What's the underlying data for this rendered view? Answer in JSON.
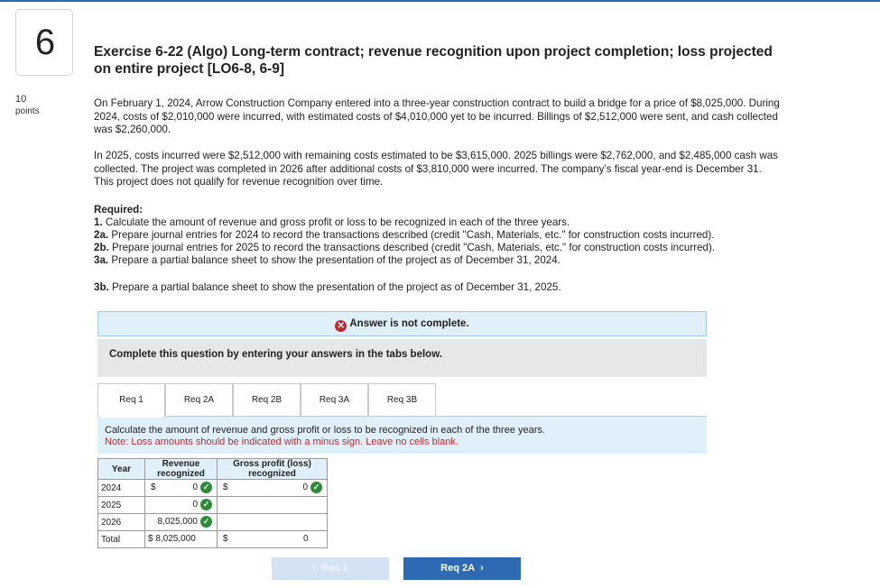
{
  "question": {
    "number": "6",
    "points_value": "10",
    "points_label": "points"
  },
  "title": "Exercise 6-22 (Algo) Long-term contract; revenue recognition upon project completion; loss projected on entire project [LO6-8, 6-9]",
  "paragraphs": [
    "On February 1, 2024, Arrow Construction Company entered into a three-year construction contract to build a bridge for a price of $8,025,000. During 2024, costs of $2,010,000 were incurred, with estimated costs of $4,010,000 yet to be incurred. Billings of $2,512,000 were sent, and cash collected was $2,260,000.",
    "In 2025, costs incurred were $2,512,000 with remaining costs estimated to be $3,615,000. 2025 billings were $2,762,000, and $2,485,000 cash was collected. The project was completed in 2026 after additional costs of $3,810,000 were incurred. The company’s fiscal year-end is December 31. This project does not qualify for revenue recognition over time."
  ],
  "required": {
    "heading": "Required:",
    "items": [
      {
        "num": "1.",
        "text": " Calculate the amount of revenue and gross profit or loss to be recognized in each of the three years."
      },
      {
        "num": "2a.",
        "text": " Prepare journal entries for 2024 to record the transactions described (credit \"Cash, Materials, etc.\" for construction costs incurred)."
      },
      {
        "num": "2b.",
        "text": " Prepare journal entries for 2025 to record the transactions described (credit \"Cash, Materials, etc.\" for construction costs incurred)."
      },
      {
        "num": "3a.",
        "text": " Prepare a partial balance sheet to show the presentation of the project as of December 31, 2024."
      },
      {
        "num": "3b.",
        "text": " Prepare a partial balance sheet to show the presentation of the project as of December 31, 2025."
      }
    ]
  },
  "status": {
    "text": "Answer is not complete.",
    "icon": "x-circle-icon",
    "color": "#c0282d"
  },
  "instruction": "Complete this question by entering your answers in the tabs below.",
  "tabs": [
    {
      "label": "Req 1"
    },
    {
      "label": "Req 2A"
    },
    {
      "label": "Req 2B"
    },
    {
      "label": "Req 3A"
    },
    {
      "label": "Req 3B"
    }
  ],
  "active_tab": "Req 1",
  "panel": {
    "text": "Calculate the amount of revenue and gross profit or loss to be recognized in each of the three years.",
    "note": "Note: Loss amounts should be indicated with a minus sign. Leave no cells blank."
  },
  "table": {
    "headers": [
      "Year",
      "Revenue recognized",
      "Gross profit (loss) recognized"
    ],
    "currency": "$",
    "rows": [
      {
        "year": "2024",
        "revenue": "0",
        "gross_profit": "0"
      },
      {
        "year": "2025",
        "revenue": "0",
        "gross_profit": ""
      },
      {
        "year": "2026",
        "revenue": "8,025,000",
        "gross_profit": ""
      }
    ],
    "total": {
      "label": "Total",
      "revenue": "$ 8,025,000",
      "gross_profit": "0"
    }
  },
  "nav": {
    "prev_label": "Req 1",
    "next_label": "Req 2A"
  },
  "colors": {
    "accent": "#2d6ab3",
    "correct": "#2e8b3a",
    "error": "#c0282d",
    "panel_bg": "#dff0fa"
  }
}
